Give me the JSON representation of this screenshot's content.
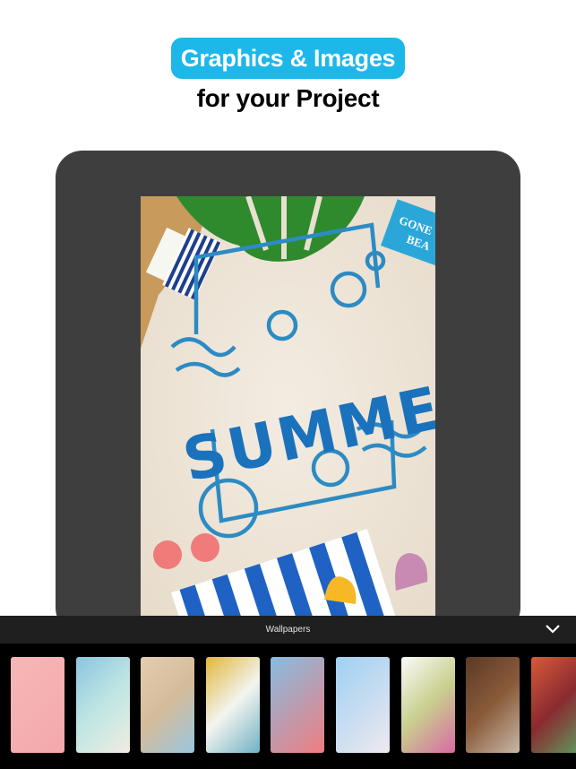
{
  "header": {
    "badge": "Graphics & Images",
    "subtitle": "for your Project"
  },
  "poster": {
    "headline": "SUMMER",
    "sign_text": "GONE BEA",
    "accent": "#1a72bc"
  },
  "panel": {
    "category_label": "Wallpapers",
    "collapse_icon": "chevron-down-icon"
  },
  "thumbnails": [
    {
      "name": "pink-headphones",
      "colors": [
        "#f6b6b6",
        "#f4a9ab"
      ]
    },
    {
      "name": "tropical-beach",
      "colors": [
        "#8cc3e0",
        "#bfe6e3",
        "#f0ece2"
      ]
    },
    {
      "name": "arch-seaview",
      "colors": [
        "#e3cdb0",
        "#d4bc9a",
        "#9ac6e0"
      ]
    },
    {
      "name": "yellow-blue-road",
      "colors": [
        "#e0b63a",
        "#f4f4f0",
        "#6fb1c4"
      ]
    },
    {
      "name": "join-us-letters",
      "colors": [
        "#86bde3",
        "#ef7d7e"
      ]
    },
    {
      "name": "makeup-pouch",
      "colors": [
        "#9ed0f2",
        "#eee9f0"
      ]
    },
    {
      "name": "confetti-petals",
      "colors": [
        "#fbfbf8",
        "#c9cf8e",
        "#d869a5"
      ]
    },
    {
      "name": "food-table",
      "colors": [
        "#5a3a25",
        "#8a5b3a",
        "#c8b8a8"
      ]
    },
    {
      "name": "bokeh-lights",
      "colors": [
        "#d85a3a",
        "#8a2a30",
        "#5aa060"
      ]
    }
  ]
}
